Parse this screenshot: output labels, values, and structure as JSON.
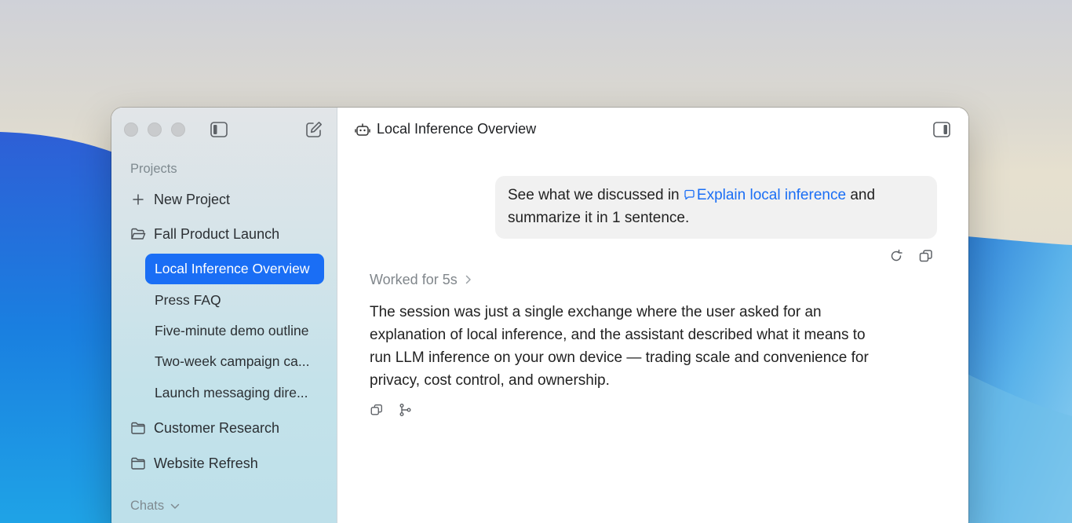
{
  "window": {
    "title": "Local Inference Overview"
  },
  "sidebar": {
    "projects_label": "Projects",
    "new_project_label": "New Project",
    "projects": [
      {
        "label": "Fall Product Launch",
        "chats": [
          {
            "label": "Local Inference Overview",
            "active": true
          },
          {
            "label": "Press FAQ"
          },
          {
            "label": "Five-minute demo outline"
          },
          {
            "label": "Two-week campaign ca..."
          },
          {
            "label": "Launch messaging dire..."
          }
        ]
      },
      {
        "label": "Customer Research"
      },
      {
        "label": "Website Refresh"
      }
    ],
    "chats_label": "Chats"
  },
  "conversation": {
    "user_message": {
      "prefix": "See what we discussed in",
      "reference": "Explain local inference",
      "suffix": "and summarize it in 1 sentence."
    },
    "worked_label": "Worked for 5s",
    "assistant_message": "The session was just a single exchange where the user asked for an explanation of local inference, and the assistant described what it means to run LLM inference on your own device — trading scale and convenience for privacy, cost control, and ownership."
  },
  "colors": {
    "accent": "#1a6ef5",
    "bubble_bg": "#f1f1f1"
  }
}
